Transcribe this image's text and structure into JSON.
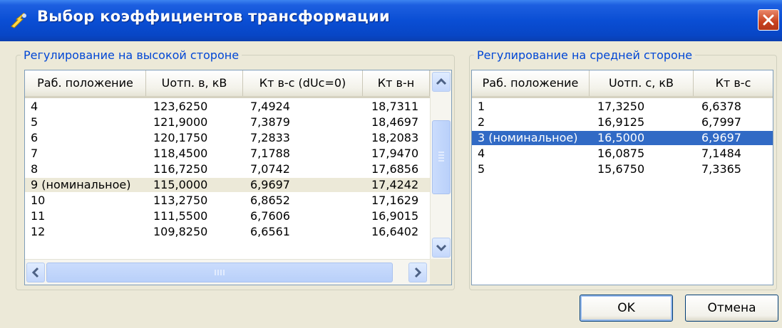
{
  "window": {
    "title": "Выбор коэффициентов трансформации"
  },
  "left_panel": {
    "legend": "Регулирование на высокой стороне",
    "columns": [
      "Раб. положение",
      "Uотп. в, кВ",
      "Кт в-с (dUc=0)",
      "Кт в-н"
    ],
    "rows": [
      [
        "4",
        "123,6250",
        "7,4924",
        "18,7311"
      ],
      [
        "5",
        "121,9000",
        "7,3879",
        "18,4697"
      ],
      [
        "6",
        "120,1750",
        "7,2833",
        "18,2083"
      ],
      [
        "7",
        "118,4500",
        "7,1788",
        "17,9470"
      ],
      [
        "8",
        "116,7250",
        "7,0742",
        "17,6856"
      ],
      [
        "9 (номинальное)",
        "115,0000",
        "6,9697",
        "17,4242"
      ],
      [
        "10",
        "113,2750",
        "6,8652",
        "17,1629"
      ],
      [
        "11",
        "111,5500",
        "6,7606",
        "16,9015"
      ],
      [
        "12",
        "109,8250",
        "6,6561",
        "16,6402"
      ]
    ],
    "selected_row_index": 5
  },
  "right_panel": {
    "legend": "Регулирование на средней стороне",
    "columns": [
      "Раб. положение",
      "Uотп. с, кВ",
      "Кт в-с"
    ],
    "rows": [
      [
        "1",
        "17,3250",
        "6,6378"
      ],
      [
        "2",
        "16,9125",
        "6,7997"
      ],
      [
        "3 (номинальное)",
        "16,5000",
        "6,9697"
      ],
      [
        "4",
        "16,0875",
        "7,1484"
      ],
      [
        "5",
        "15,6750",
        "7,3365"
      ]
    ],
    "selected_row_index": 2
  },
  "buttons": {
    "ok": "OK",
    "cancel": "Отмена"
  },
  "colors": {
    "title_bar": "#0a4ed4",
    "selection_blue": "#316ac5",
    "selection_inactive": "#ece9d8",
    "legend_text": "#0046d5"
  }
}
